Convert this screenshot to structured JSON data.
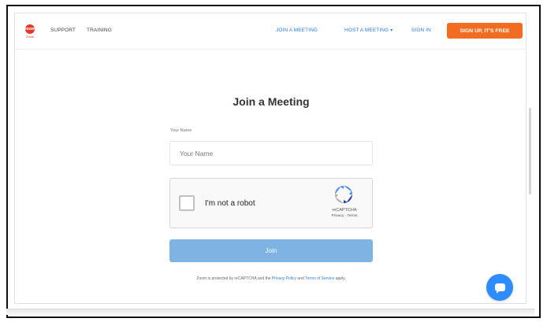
{
  "header": {
    "logo_text": "zoom",
    "logo_sub": "Zoom",
    "support_label": "SUPPORT",
    "training_label": "TRAINING",
    "join_meeting_label": "JOIN A MEETING",
    "host_meeting_label": "HOST A MEETING",
    "host_caret": "▾",
    "sign_in_label": "SIGN IN",
    "signup_label": "SIGN UP, IT'S FREE"
  },
  "main": {
    "title": "Join a Meeting",
    "name_field": {
      "label": "Your Name",
      "placeholder": "Your Name",
      "value": ""
    },
    "recaptcha": {
      "checkbox_label": "I'm not a robot",
      "brand": "reCAPTCHA",
      "links": "Privacy - Terms"
    },
    "join_label": "Join",
    "footnote": {
      "prefix": "Zoom is protected by reCAPTCHA and the ",
      "privacy_link": "Privacy Policy",
      "middle": " and ",
      "terms_link": "Terms of Service",
      "suffix": " apply."
    }
  },
  "colors": {
    "accent": "#2d7ee0",
    "signup_button": "#f26d21",
    "join_button_disabled": "#7fb3e3",
    "chat_button": "#2d8cff"
  },
  "icons": {
    "logo": "zoom-logo-icon",
    "recaptcha": "recaptcha-logo-icon",
    "chat": "chat-bubble-icon"
  }
}
